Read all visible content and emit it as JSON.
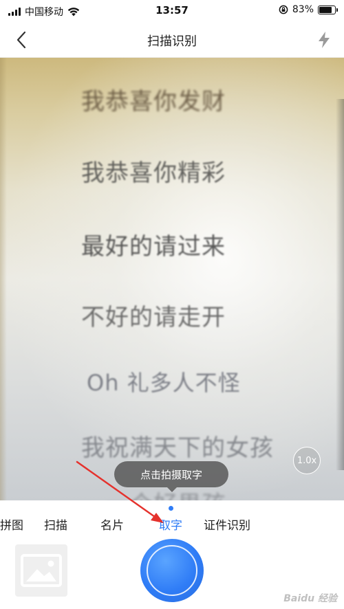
{
  "status_bar": {
    "carrier": "中国移动",
    "time": "13:57",
    "battery_percent": "83%",
    "battery_level": 0.83
  },
  "nav": {
    "title": "扫描识别"
  },
  "preview": {
    "document_lines": [
      "我恭喜你发财",
      "我恭喜你精彩",
      "最好的请过来",
      "不好的请走开",
      "Oh 礼多人不怪",
      "我祝满天下的女孩",
      "...一个好男孩"
    ],
    "zoom_label": "1.0x",
    "tooltip": "点击拍摄取字"
  },
  "modes": {
    "items": [
      {
        "label": "拼图"
      },
      {
        "label": "扫描"
      },
      {
        "label": "名片"
      },
      {
        "label": "取字",
        "active": true
      },
      {
        "label": "证件识别"
      }
    ]
  },
  "watermark": "Baidu 经验",
  "colors": {
    "accent": "#2f7cf6",
    "tooltip_bg": "#505050",
    "annotation_arrow": "#e5322d"
  }
}
